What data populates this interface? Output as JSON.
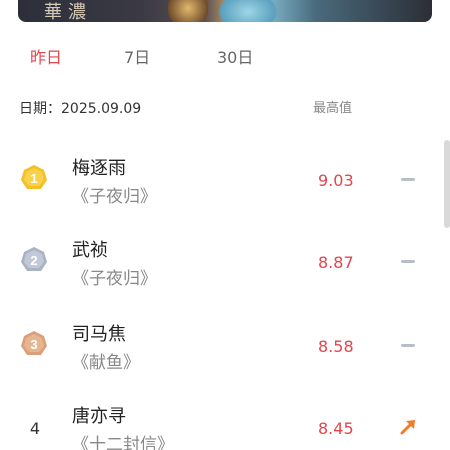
{
  "banner": {
    "calligraphy": "華濃"
  },
  "tabs": [
    {
      "label": "昨日",
      "active": true
    },
    {
      "label": "7日",
      "active": false
    },
    {
      "label": "30日",
      "active": false
    }
  ],
  "date_label": "日期：2025.09.09",
  "max_label": "最高值",
  "colors": {
    "accent": "#e0474c",
    "gold": "#f4c026",
    "silver": "#aab3c4",
    "bronze": "#d9a07a",
    "trend_flat": "#b9bec6",
    "trend_up": "#f27a2a"
  },
  "rankings": [
    {
      "rank": "1",
      "badge": "gold-medal-icon",
      "name": "梅逐雨",
      "drama": "《子夜归》",
      "score": "9.03",
      "trend": "flat"
    },
    {
      "rank": "2",
      "badge": "silver-medal-icon",
      "name": "武祯",
      "drama": "《子夜归》",
      "score": "8.87",
      "trend": "flat"
    },
    {
      "rank": "3",
      "badge": "bronze-medal-icon",
      "name": "司马焦",
      "drama": "《献鱼》",
      "score": "8.58",
      "trend": "flat"
    },
    {
      "rank": "4",
      "badge": "",
      "name": "唐亦寻",
      "drama": "《十二封信》",
      "score": "8.45",
      "trend": "up"
    }
  ]
}
